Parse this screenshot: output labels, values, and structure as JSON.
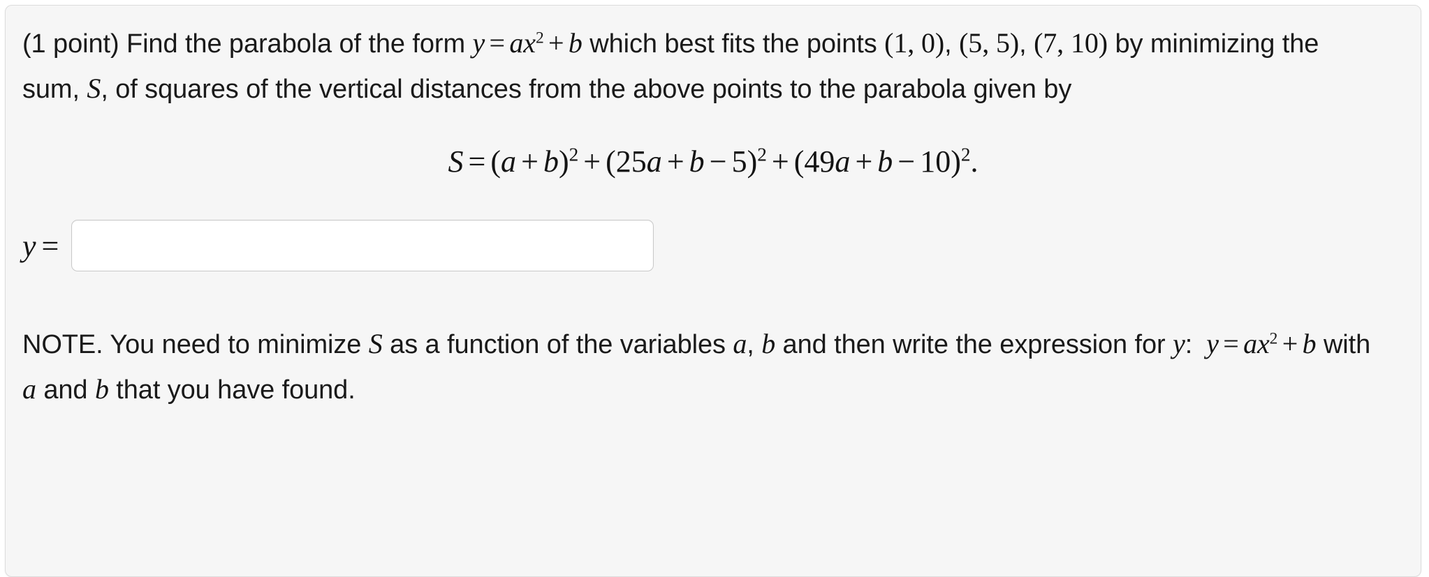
{
  "panel": {
    "background_color": "#f6f6f6",
    "border_color": "#dcdcdc"
  },
  "problem": {
    "points_tag": "(1 point)",
    "line1": {
      "before_eq": " Find the parabola of the form ",
      "eq_y": "y",
      "eq_equals": "=",
      "eq_a": "a",
      "eq_x": "x",
      "eq_exp": "2",
      "eq_plus": "+",
      "eq_b": "b",
      "after_eq": " which best fits the points ",
      "point1": "(1, 0)",
      "comma1": ", ",
      "point2": "(5, 5)",
      "comma2": ","
    },
    "line2": {
      "point3": "(7, 10)",
      "text_a": " by minimizing the sum, ",
      "sym_S": "S",
      "text_b": ", of squares of the vertical distances from the above points to"
    },
    "line3": "the parabola given by"
  },
  "display_equation": {
    "lhs": "S",
    "equals": "=",
    "term1_open": "(",
    "term1_a": "a",
    "term1_plus": "+",
    "term1_b": "b",
    "term1_close": ")",
    "term1_exp": "2",
    "plus1": "+",
    "term2_open": "(",
    "term2_coeff": "25",
    "term2_a": "a",
    "term2_plus": "+",
    "term2_b": "b",
    "term2_minus": "−",
    "term2_const": "5",
    "term2_close": ")",
    "term2_exp": "2",
    "plus2": "+",
    "term3_open": "(",
    "term3_coeff": "49",
    "term3_a": "a",
    "term3_plus": "+",
    "term3_b": "b",
    "term3_minus": "−",
    "term3_const": "10",
    "term3_close": ")",
    "term3_exp": "2",
    "period": "."
  },
  "answer": {
    "label_var": "y",
    "label_equals": "=",
    "value": "",
    "placeholder": ""
  },
  "note": {
    "prefix": "NOTE.",
    "text_a": " You need to minimize ",
    "sym_S": "S",
    "text_b": " as a function of the variables ",
    "var_a": "a",
    "comma": ", ",
    "var_b": "b",
    "text_c": " and then write the expression",
    "text_d": "for ",
    "var_y_label": "y",
    "colon": ":",
    "eq_y": "y",
    "eq_equals": "=",
    "eq_a": "a",
    "eq_x": "x",
    "eq_exp": "2",
    "eq_plus": "+",
    "eq_b": "b",
    "text_e": " with ",
    "var_a2": "a",
    "text_f": " and ",
    "var_b2": "b",
    "text_g": " that you have found."
  }
}
